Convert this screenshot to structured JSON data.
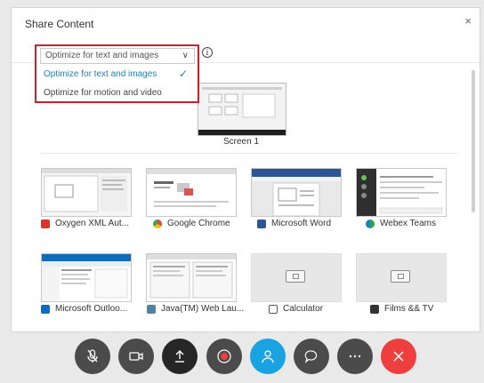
{
  "dialog": {
    "title": "Share Content",
    "close_glyph": "×"
  },
  "optimize": {
    "selected_value": "Optimize for text and images",
    "chevron_glyph": "∨",
    "options": [
      {
        "label": "Optimize for text and images",
        "selected": true
      },
      {
        "label": "Optimize for motion and video",
        "selected": false
      }
    ],
    "check_glyph": "✓",
    "info_glyph": "i"
  },
  "screen": {
    "label": "Screen 1"
  },
  "apps": [
    {
      "label": "Oxygen XML Aut...",
      "icon": "oxygen-xml-icon",
      "color": "#d9342b"
    },
    {
      "label": "Google Chrome",
      "icon": "chrome-icon",
      "color": "#e94235"
    },
    {
      "label": "Microsoft Word",
      "icon": "word-icon",
      "color": "#2b579a"
    },
    {
      "label": "Webex Teams",
      "icon": "webex-teams-icon",
      "color": "#2aa34a"
    },
    {
      "label": "Microsoft Outloo...",
      "icon": "outlook-icon",
      "color": "#0f6cbd"
    },
    {
      "label": "Java(TM) Web Lau...",
      "icon": "java-icon",
      "color": "#5382a1"
    },
    {
      "label": "Calculator",
      "icon": "calculator-icon",
      "color": "#555555"
    },
    {
      "label": "Films && TV",
      "icon": "films-tv-icon",
      "color": "#333333"
    }
  ],
  "controls": [
    {
      "name": "mute",
      "icon": "microphone-muted-icon",
      "color": "#4b4b4b"
    },
    {
      "name": "video",
      "icon": "video-camera-icon",
      "color": "#4b4b4b"
    },
    {
      "name": "share",
      "icon": "share-upload-icon",
      "color": "#262626"
    },
    {
      "name": "record",
      "icon": "record-icon",
      "color": "#4b4b4b"
    },
    {
      "name": "participants",
      "icon": "participants-icon",
      "color": "#19a3e0"
    },
    {
      "name": "chat",
      "icon": "chat-bubble-icon",
      "color": "#4b4b4b"
    },
    {
      "name": "more",
      "icon": "more-options-icon",
      "color": "#4b4b4b"
    },
    {
      "name": "leave",
      "icon": "leave-meeting-icon",
      "color": "#ee3e3e"
    }
  ]
}
